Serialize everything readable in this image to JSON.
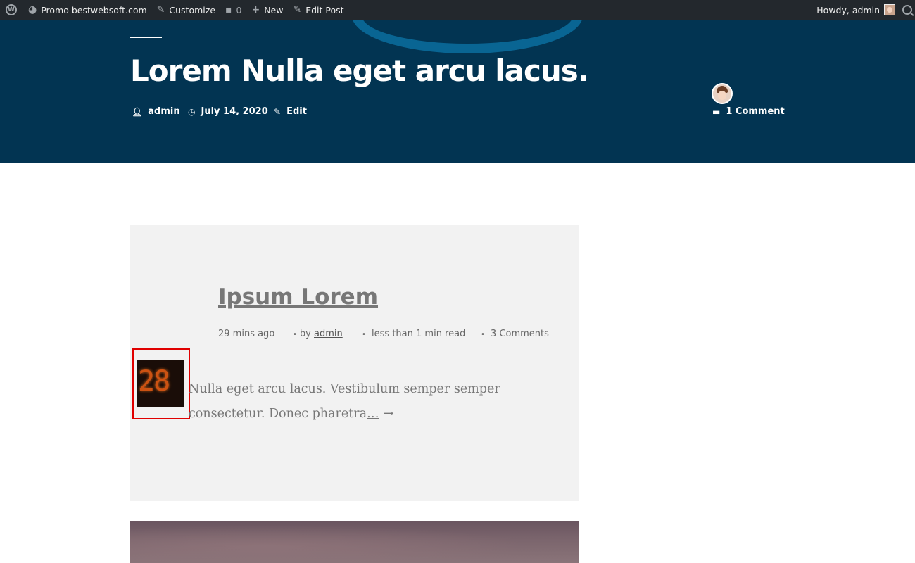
{
  "adminbar": {
    "wp_logo": "W",
    "site_name": "Promo bestwebsoft.com",
    "customize": "Customize",
    "comments_count": "0",
    "new_label": "New",
    "edit_post": "Edit Post",
    "howdy": "Howdy, admin"
  },
  "post": {
    "title": "Lorem Nulla eget arcu lacus.",
    "author": "admin",
    "date": "July 14, 2020",
    "edit": "Edit",
    "comments": "1 Comment"
  },
  "card": {
    "title": "Ipsum Lorem",
    "time_ago": "29 mins ago",
    "by_label": "by",
    "author": "admin",
    "read_time": "less than 1 min read",
    "comments": "3 Comments",
    "thumb_text": "28",
    "excerpt_text": "Nulla eget arcu lacus. Vestibulum semper semper consectetur. Donec pharetra",
    "read_more": "…",
    "arrow": "→"
  },
  "colors": {
    "adminbar_bg": "#23282d",
    "header_bg": "#023452",
    "card_bg": "#f2f2f2",
    "highlight_border": "#e00000"
  }
}
